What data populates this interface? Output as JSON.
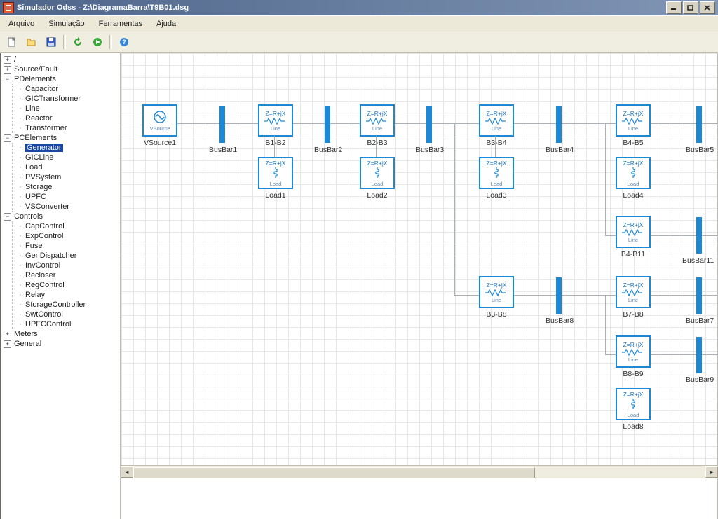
{
  "window": {
    "title": "Simulador Odss - Z:\\DiagramaBarra\\T9B01.dsg"
  },
  "menu": {
    "file": "Arquivo",
    "sim": "Simulação",
    "tools": "Ferramentas",
    "help": "Ajuda"
  },
  "toolbar_icons": {
    "new": "new-file-icon",
    "open": "open-folder-icon",
    "save": "save-icon",
    "sep": "|",
    "run_refresh": "refresh-icon",
    "run_play": "play-icon",
    "help": "help-icon"
  },
  "tree": {
    "root": "/",
    "source": "Source/Fault",
    "pdelements": {
      "label": "PDelements",
      "items": [
        "Capacitor",
        "GICTransformer",
        "Line",
        "Reactor",
        "Transformer"
      ]
    },
    "pcelements": {
      "label": "PCElements",
      "items": [
        "Generator",
        "GICLine",
        "Load",
        "PVSystem",
        "Storage",
        "UPFC",
        "VSConverter"
      ],
      "selected_index": 0
    },
    "controls": {
      "label": "Controls",
      "items": [
        "CapControl",
        "ExpControl",
        "Fuse",
        "GenDispatcher",
        "InvControl",
        "Recloser",
        "RegControl",
        "Relay",
        "StorageController",
        "SwtControl",
        "UPFCControl"
      ]
    },
    "meters": "Meters",
    "general": "General"
  },
  "schematic": {
    "imp_label": "Z=R+jX",
    "line_label": "Line",
    "load_label": "Load",
    "vsource_label": "VSource",
    "source": {
      "label": "VSource1"
    },
    "busbars": [
      "BusBar1",
      "BusBar2",
      "BusBar3",
      "BusBar4",
      "BusBar5",
      "BusBar11",
      "BusBar8",
      "BusBar7",
      "BusBar9"
    ],
    "lines": {
      "b1b2": "B1-B2",
      "b2b3": "B2-B3",
      "b3b4": "B3-B4",
      "b4b5": "B4-B5",
      "b4b11": "B4-B11",
      "b3b8": "B3-B8",
      "b7b8": "B7-B8",
      "b8b9": "B8-B9"
    },
    "loads": {
      "l1": "Load1",
      "l2": "Load2",
      "l3": "Load3",
      "l4": "Load4",
      "l8": "Load8"
    }
  }
}
